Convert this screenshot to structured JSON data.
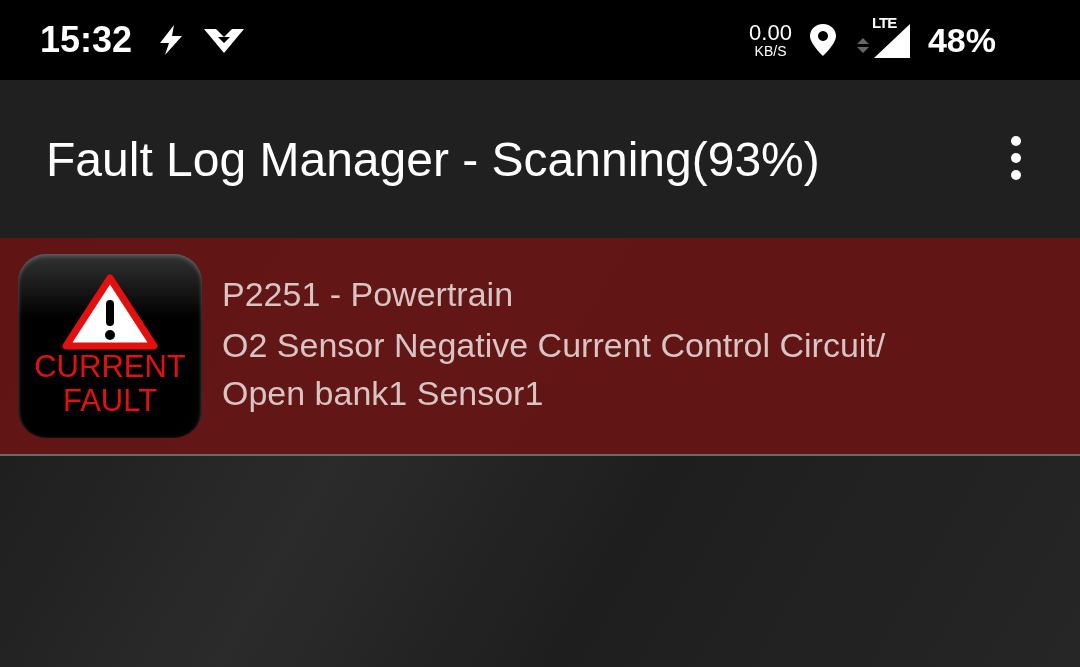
{
  "status_bar": {
    "time": "15:32",
    "net_speed": "0.00",
    "net_unit": "KB/S",
    "network": "LTE",
    "battery": "48%"
  },
  "app_bar": {
    "title": "Fault Log Manager - Scanning(93%)"
  },
  "faults": [
    {
      "kind": "current",
      "badge_lines": [
        "CURRENT",
        "FAULT"
      ],
      "code": "P2251 - Powertrain",
      "description": "O2 Sensor Negative Current Control Circuit/ Open bank1 Sensor1",
      "color": "#6b1414"
    }
  ]
}
